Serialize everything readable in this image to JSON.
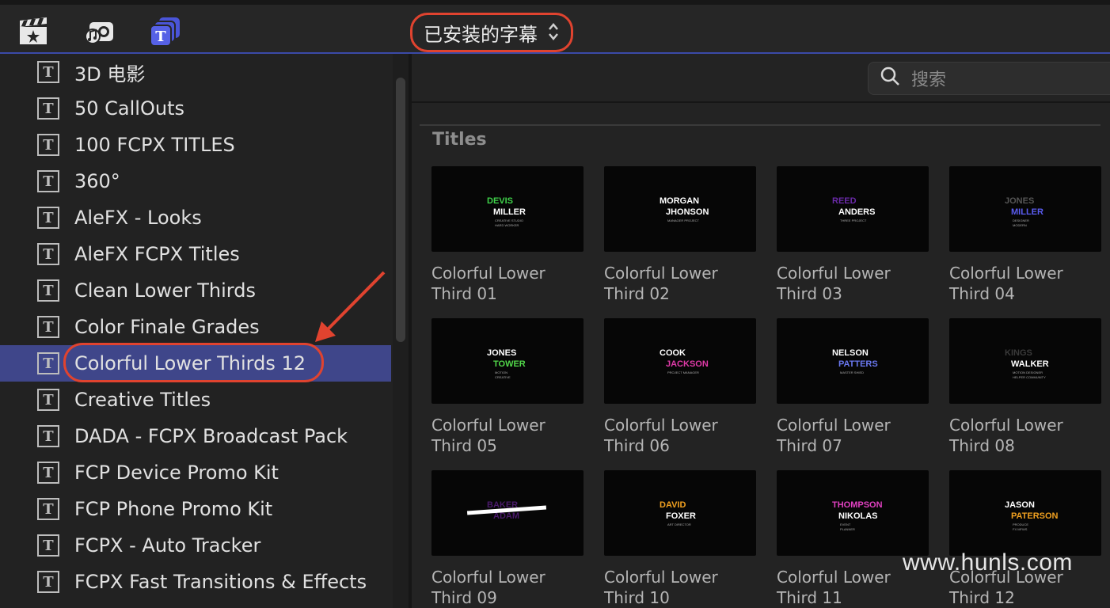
{
  "toolbar": {
    "dropdown_label": "已安装的字幕",
    "dropdown_chevron": "⌃⌄"
  },
  "sidebar": {
    "items": [
      {
        "label": "3D 电影"
      },
      {
        "label": "50 CallOuts"
      },
      {
        "label": "100 FCPX TITLES"
      },
      {
        "label": "360°"
      },
      {
        "label": "AleFX - Looks"
      },
      {
        "label": "AleFX FCPX Titles"
      },
      {
        "label": "Clean Lower Thirds"
      },
      {
        "label": "Color Finale Grades"
      },
      {
        "label": "Colorful Lower Thirds 12",
        "selected": true
      },
      {
        "label": "Creative Titles"
      },
      {
        "label": "DADA - FCPX Broadcast Pack"
      },
      {
        "label": "FCP Device Promo Kit"
      },
      {
        "label": "FCP Phone Promo Kit"
      },
      {
        "label": "FCPX - Auto Tracker"
      },
      {
        "label": "FCPX Fast Transitions & Effects"
      }
    ],
    "item_icon": "title-t-icon",
    "icon_glyph": "T"
  },
  "search": {
    "placeholder": "搜索"
  },
  "section": {
    "title": "Titles"
  },
  "tiles": [
    {
      "caption": "Colorful Lower Third 01",
      "t1": "DEVIS",
      "t2": "MILLER",
      "s1": "CREATIVE STUDIO",
      "s2": "HARD WORKER",
      "c1": "#3fd24a",
      "c2": "#ffffff"
    },
    {
      "caption": "Colorful Lower Third 02",
      "t1": "MORGAN",
      "t2": "JHONSON",
      "s1": "MANAGER PROJECT",
      "s2": "",
      "c1": "#ffffff",
      "c2": "#ffffff"
    },
    {
      "caption": "Colorful Lower Third 03",
      "t1": "REED",
      "t2": "ANDERS",
      "s1": "THREE PROJECT",
      "s2": "",
      "c1": "#6a2aa8",
      "c2": "#ffffff"
    },
    {
      "caption": "Colorful Lower Third 04",
      "t1": "JONES",
      "t2": "MILLER",
      "s1": "DESIGNER",
      "s2": "MODERN",
      "c1": "#555555",
      "c2": "#5a5cf0"
    },
    {
      "caption": "Colorful Lower Third 05",
      "t1": "JONES",
      "t2": "TOWER",
      "s1": "MOTION",
      "s2": "CREATIVE",
      "c1": "#ffffff",
      "c2": "#52d84a"
    },
    {
      "caption": "Colorful Lower Third 06",
      "t1": "COOK",
      "t2": "JACKSON",
      "s1": "PROJECT MANAGER",
      "s2": "",
      "c1": "#ffffff",
      "c2": "#e03aa8"
    },
    {
      "caption": "Colorful Lower Third 07",
      "t1": "NELSON",
      "t2": "PATTERS",
      "s1": "MASTER SHIED",
      "s2": "",
      "c1": "#ffffff",
      "c2": "#6a78f0"
    },
    {
      "caption": "Colorful Lower Third 08",
      "t1": "KINGS",
      "t2": "WALKER",
      "s1": "MOTION DESIGNER",
      "s2": "HELPER COMMUNITY",
      "c1": "#3a3a3a",
      "c2": "#ffffff"
    },
    {
      "caption": "Colorful Lower Third 09",
      "t1": "BAKER",
      "t2": "ADAM",
      "s1": "",
      "s2": "",
      "c1": "#4a1a6a",
      "c2": "#4a1a6a"
    },
    {
      "caption": "Colorful Lower Third 10",
      "t1": "DAVID",
      "t2": "FOXER",
      "s1": "ART DIRECTOR",
      "s2": "",
      "c1": "#f0a020",
      "c2": "#ffffff"
    },
    {
      "caption": "Colorful Lower Third 11",
      "t1": "THOMPSON",
      "t2": "NIKOLAS",
      "s1": "EVENT",
      "s2": "PLANNER",
      "c1": "#e040c0",
      "c2": "#ffffff"
    },
    {
      "caption": "Colorful Lower Third 12",
      "t1": "JASON",
      "t2": "PATERSON",
      "s1": "PRODUCE",
      "s2": "FX MFWS",
      "c1": "#ffffff",
      "c2": "#f0a020"
    }
  ],
  "watermark": "www.hunls.com",
  "colors": {
    "accent": "#3f468a",
    "highlight": "#e0432f",
    "toolbar_blue": "#4a55d8"
  }
}
